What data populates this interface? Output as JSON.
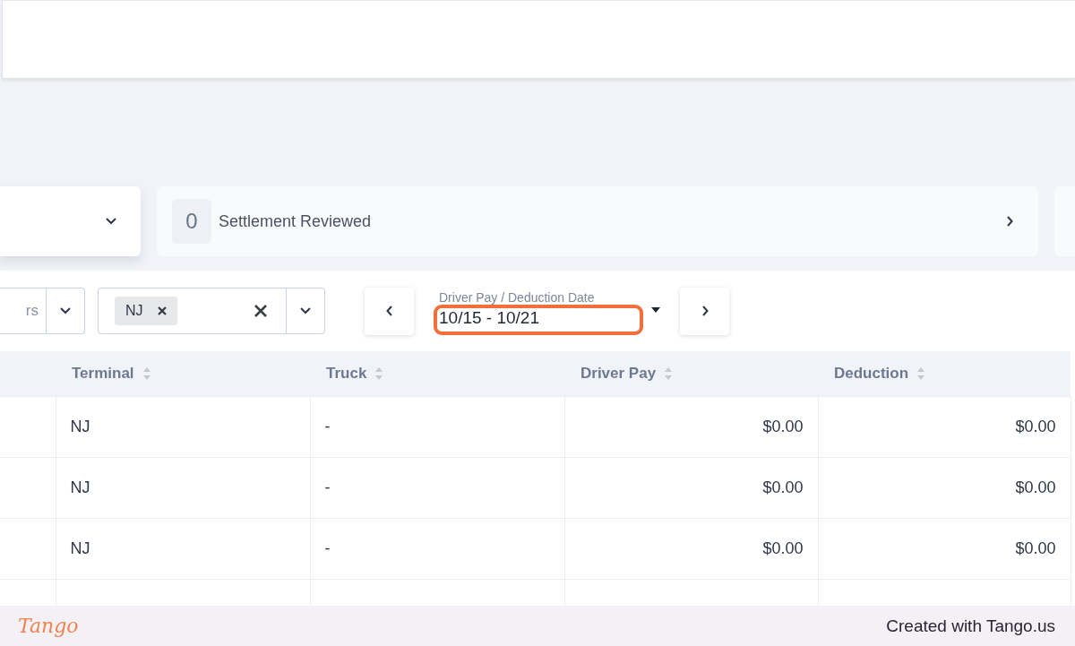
{
  "status_card": {
    "count": "0",
    "label": "Settlement Reviewed"
  },
  "filters": {
    "first_select": {
      "value": "rs"
    },
    "terminal_select": {
      "chips": [
        "NJ"
      ]
    },
    "date_picker": {
      "label": "Driver Pay / Deduction Date",
      "value": "10/15 - 10/21",
      "highlighted": true
    }
  },
  "table": {
    "columns": [
      {
        "label": "Terminal",
        "sortable": true
      },
      {
        "label": "Truck",
        "sortable": true
      },
      {
        "label": "Driver Pay",
        "sortable": true
      },
      {
        "label": "Deduction",
        "sortable": true
      }
    ],
    "rows": [
      {
        "cells": [
          "NJ",
          "-",
          "$0.00",
          "$0.00"
        ]
      },
      {
        "cells": [
          "NJ",
          "-",
          "$0.00",
          "$0.00"
        ]
      },
      {
        "cells": [
          "NJ",
          "-",
          "$0.00",
          "$0.00"
        ]
      }
    ]
  },
  "footer": {
    "logo": "Tango",
    "text": "Created with Tango.us"
  }
}
